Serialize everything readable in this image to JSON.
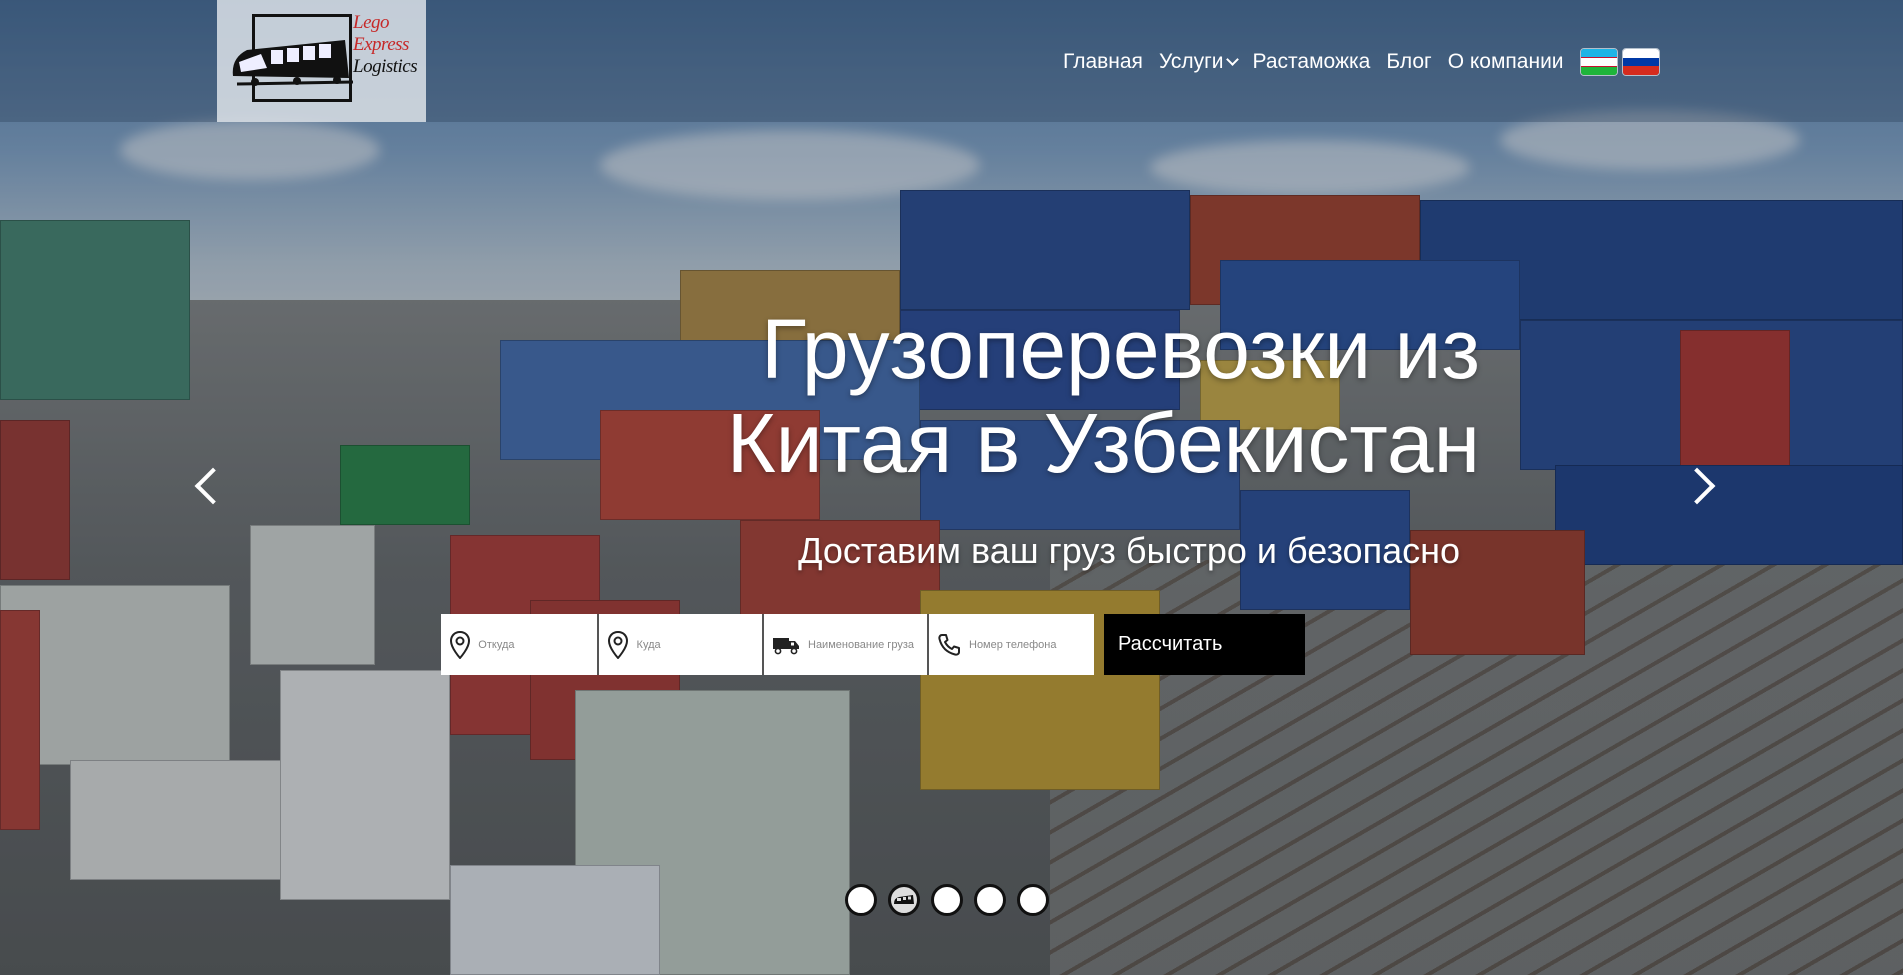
{
  "header": {
    "logo": {
      "line1": "Lego",
      "line2": "Express",
      "line3": "Logistics"
    },
    "nav": [
      {
        "label": "Главная"
      },
      {
        "label": "Услуги",
        "has_dropdown": true
      },
      {
        "label": "Растаможка"
      },
      {
        "label": "Блог"
      },
      {
        "label": "О компании"
      }
    ],
    "languages": [
      "uz-flag-icon",
      "ru-flag-icon"
    ]
  },
  "hero": {
    "title_line1": "Грузоперевозки из",
    "title_line2": "Китая в Узбекистан",
    "subtitle": "Доставим ваш груз быстро и безопасно"
  },
  "calculator": {
    "from_placeholder": "Откуда",
    "to_placeholder": "Куда",
    "cargo_placeholder": "Наименование груза",
    "phone_placeholder": "Номер телефона",
    "submit_label": "Рассчитать"
  },
  "slider": {
    "slide_count": 5,
    "active_index": 1
  },
  "colors": {
    "accent": "#000000",
    "logo_red": "#c62828",
    "text": "#ffffff"
  }
}
